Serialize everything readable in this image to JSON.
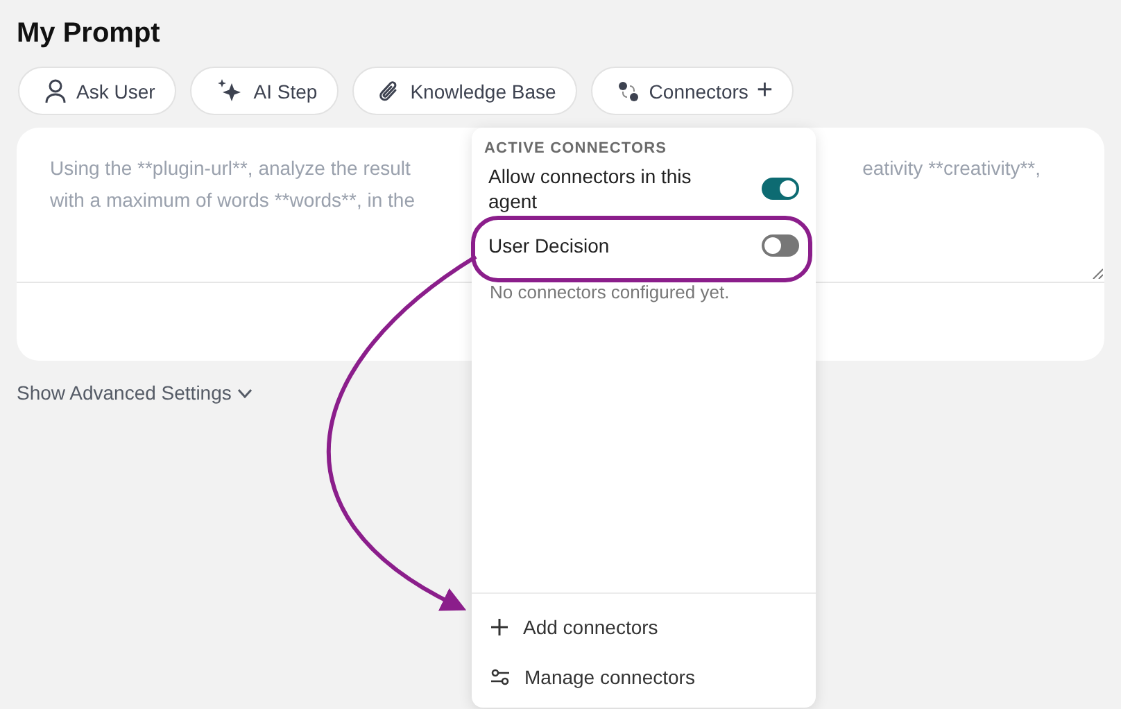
{
  "title": "My Prompt",
  "toolbar": [
    {
      "kind": "user",
      "label": "Ask User"
    },
    {
      "kind": "sparkle",
      "label": "AI Step"
    },
    {
      "kind": "clip",
      "label": "Knowledge Base"
    },
    {
      "kind": "connectors",
      "label": "Connectors",
      "trailing": "+"
    }
  ],
  "prompt": {
    "text_left": [
      "Using the **plugin-url**, analyze the result",
      "with a maximum of words **words**, in the"
    ],
    "text_right": [
      "eativity **creativity**,"
    ]
  },
  "advanced_settings": {
    "label": "Show Advanced Settings",
    "expanded": false
  },
  "connectors_menu": {
    "heading": "ACTIVE CONNECTORS",
    "toggles": [
      {
        "label": "Allow connectors in this agent",
        "on": true,
        "highlighted": false
      },
      {
        "label": "User Decision",
        "on": false,
        "highlighted": true
      }
    ],
    "empty_message": "No connectors configured yet.",
    "actions": [
      {
        "kind": "add",
        "label": "Add connectors"
      },
      {
        "kind": "manage",
        "label": "Manage connectors"
      }
    ]
  }
}
